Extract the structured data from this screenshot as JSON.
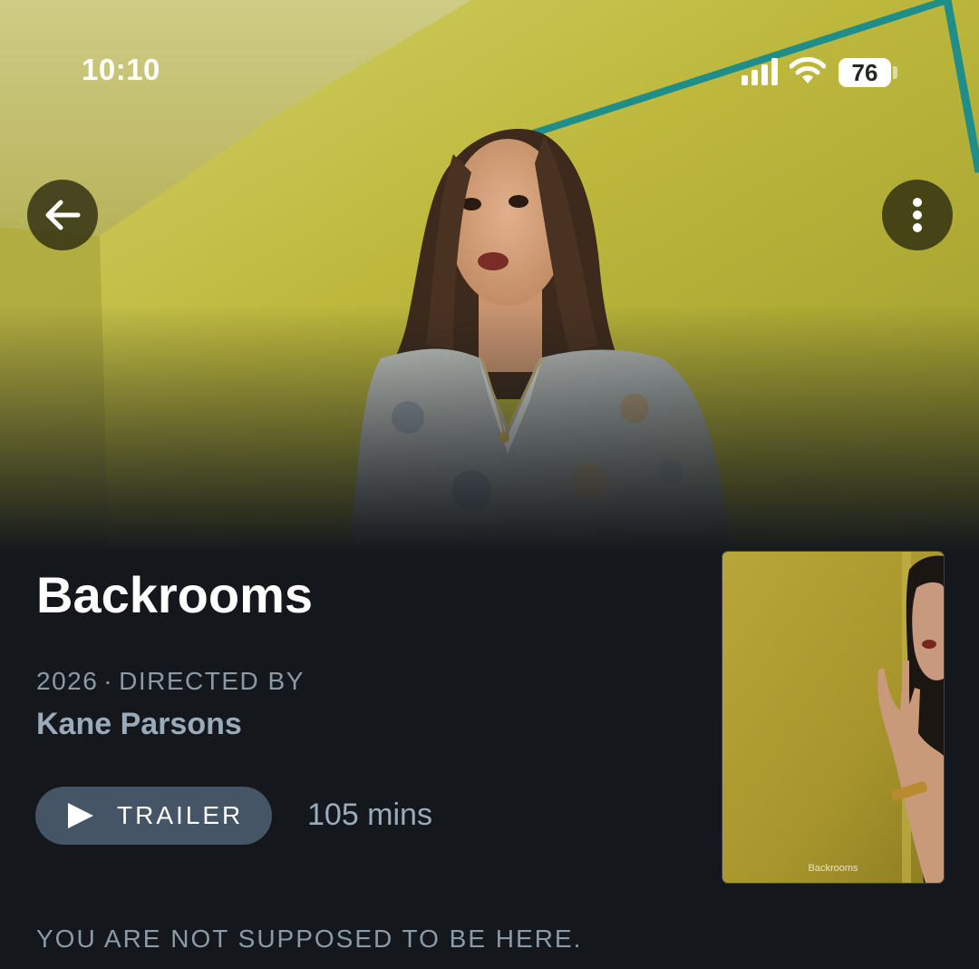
{
  "status_bar": {
    "time": "10:10",
    "battery": "76"
  },
  "nav": {
    "back_icon": "arrow-left-icon",
    "more_icon": "vertical-ellipsis-icon"
  },
  "film": {
    "title": "Backrooms",
    "year": "2026",
    "separator": "·",
    "directed_by_label": "DIRECTED BY",
    "director": "Kane Parsons",
    "trailer_label": "TRAILER",
    "runtime": "105 mins",
    "tagline": "YOU ARE NOT SUPPOSED TO BE HERE.",
    "poster_caption": "Backrooms"
  },
  "colors": {
    "background": "#14181c",
    "trailer_button": "#455566",
    "meta_text": "#8b9aa8",
    "director_text": "#99aabb",
    "backdrop_wall": "#b9b43a"
  }
}
